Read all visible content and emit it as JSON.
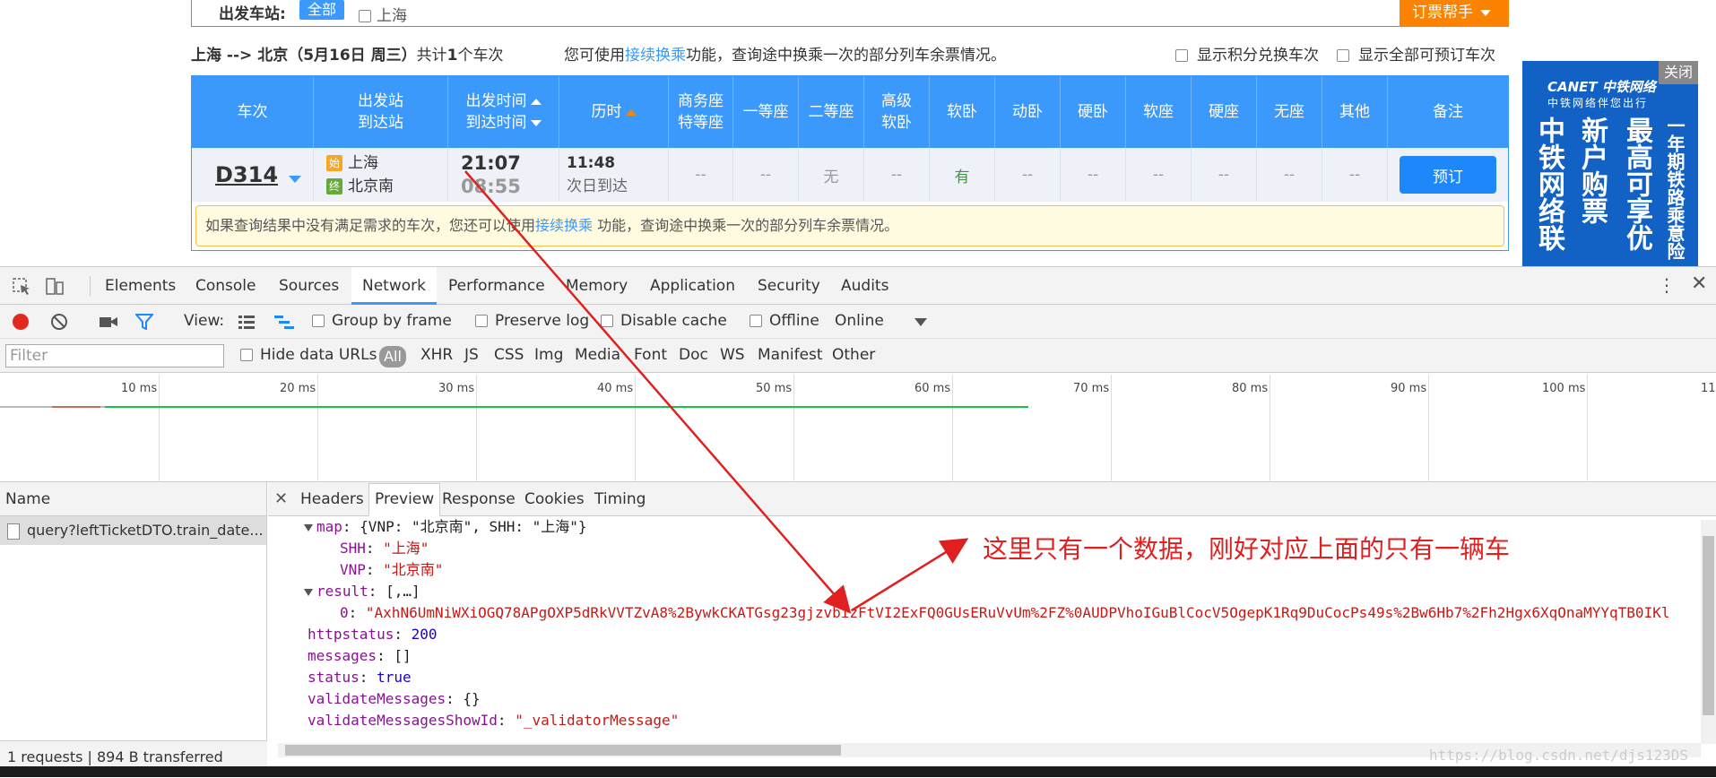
{
  "page": {
    "filter_label": "出发车站:",
    "all_chip": "全部",
    "station_option": "上海",
    "helper_button": "订票帮手",
    "route": "上海 --> 北京（5月16日 周三）",
    "count_prefix": "共计",
    "count": "1",
    "count_suffix": "个车次",
    "hint_prefix": "您可使用",
    "hint_link": "接续换乘",
    "hint_suffix": "功能，查询途中换乘一次的部分列车余票情况。",
    "opt_points": "显示积分兑换车次",
    "opt_all": "显示全部可预订车次"
  },
  "grid": {
    "headers": {
      "train": "车次",
      "station_from": "出发站",
      "station_to": "到达站",
      "time_dep": "出发时间",
      "time_arr": "到达时间",
      "duration": "历时",
      "business_1": "商务座",
      "business_2": "特等座",
      "first": "一等座",
      "second": "二等座",
      "hsoft_1": "高级",
      "hsoft_2": "软卧",
      "soft_sleeper": "软卧",
      "motor_sleeper": "动卧",
      "hard_sleeper": "硬卧",
      "soft_seat": "软座",
      "hard_seat": "硬座",
      "no_seat": "无座",
      "other": "其他",
      "remark": "备注"
    },
    "row": {
      "train_no": "D314",
      "start_tag": "始",
      "end_tag": "终",
      "from": "上海",
      "to": "北京南",
      "dep": "21:07",
      "arr": "08:55",
      "dur": "11:48",
      "dur_note": "次日到达",
      "business": "--",
      "first": "--",
      "second": "无",
      "hsoft": "--",
      "soft_sleeper": "有",
      "motor_sleeper": "--",
      "hard_sleeper": "--",
      "soft_seat": "--",
      "hard_seat": "--",
      "no_seat": "--",
      "other": "--",
      "book": "预订"
    },
    "notice_prefix": "如果查询结果中没有满足需求的车次，您还可以使用",
    "notice_link": "接续换乘",
    "notice_suffix": " 功能，查询途中换乘一次的部分列车余票情况。"
  },
  "ad": {
    "close": "关闭",
    "logo": "CANET 中铁网络",
    "sub": "中铁网络伴您出行",
    "col1": "中铁网络联",
    "col2": "新户购票",
    "col3": "最高可享优",
    "col4": "一年期铁路乘意险"
  },
  "devtools": {
    "tabs": [
      "Elements",
      "Console",
      "Sources",
      "Network",
      "Performance",
      "Memory",
      "Application",
      "Security",
      "Audits"
    ],
    "toolbar": {
      "view": "View:",
      "group_by_frame": "Group by frame",
      "preserve_log": "Preserve log",
      "disable_cache": "Disable cache",
      "offline": "Offline",
      "online": "Online"
    },
    "filter": {
      "placeholder": "Filter",
      "hide_data_urls": "Hide data URLs",
      "all": "All",
      "types": [
        "XHR",
        "JS",
        "CSS",
        "Img",
        "Media",
        "Font",
        "Doc",
        "WS",
        "Manifest",
        "Other"
      ]
    },
    "timeline_ticks": [
      "10 ms",
      "20 ms",
      "30 ms",
      "40 ms",
      "50 ms",
      "60 ms",
      "70 ms",
      "80 ms",
      "90 ms",
      "100 ms",
      "11"
    ],
    "name_header": "Name",
    "request_name": "query?leftTicketDTO.train_date...",
    "status": "1 requests  |  894 B transferred",
    "detail_tabs": [
      "Headers",
      "Preview",
      "Response",
      "Cookies",
      "Timing"
    ],
    "preview": {
      "map_line_key": "map",
      "map_line_val": "{VNP: \"北京南\", SHH: \"上海\"}",
      "shh_key": "SHH",
      "shh_val": "\"上海\"",
      "vnp_key": "VNP",
      "vnp_val": "\"北京南\"",
      "result_key": "result",
      "result_val": "[,…]",
      "item_key": "0",
      "item_val": "\"AxhN6UmNiWXiOGQ78APgOXP5dRkVVTZvA8%2BywkCKATGsg23gjzvbizFtVI2ExFQ0GUsERuVvUm%2FZ%0AUDPVhoIGuBlCocV5OgepK1Rq9DuCocPs49s%2Bw6Hb7%2Fh2Hgx6XqOnaMYYqTB0IKl",
      "httpstatus_key": "httpstatus",
      "httpstatus_val": "200",
      "messages_key": "messages",
      "messages_val": "[]",
      "status_key": "status",
      "status_val": "true",
      "vm_key": "validateMessages",
      "vm_val": "{}",
      "vmsid_key": "validateMessagesShowId",
      "vmsid_val": "\"_validatorMessage\""
    }
  },
  "annotation": "这里只有一个数据，刚好对应上面的只有一辆车",
  "watermark": "https://blog.csdn.net/djs123DS",
  "colors": {
    "brand_blue": "#3b99fc",
    "orange": "#fc8302",
    "annotation_red": "#e02020"
  }
}
